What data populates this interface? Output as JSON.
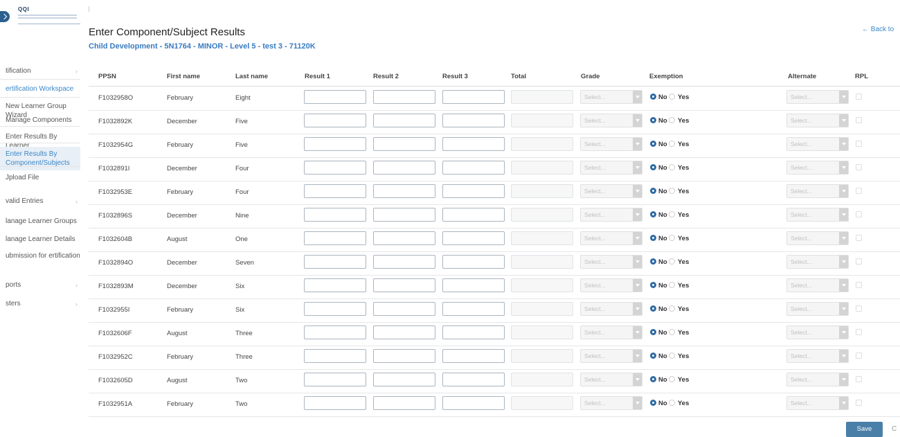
{
  "logo": {
    "text": "QQI"
  },
  "sidebar": {
    "items": [
      {
        "label": "tification",
        "chevron": true,
        "style": "plain"
      },
      {
        "label": "ertification Workspace",
        "chevron": false,
        "style": "blue"
      },
      {
        "label": "New Learner Group Wizard",
        "chevron": false,
        "style": "plain"
      },
      {
        "label": "Manage Components",
        "chevron": false,
        "style": "plain"
      },
      {
        "label": "Enter Results By Learner",
        "chevron": false,
        "style": "plain"
      },
      {
        "label": "Enter Results By Component/Subjects",
        "chevron": false,
        "style": "active"
      },
      {
        "label": "Jpload File",
        "chevron": false,
        "style": "plain"
      },
      {
        "label": "valid Entries",
        "chevron": true,
        "style": "plain"
      },
      {
        "label": "lanage Learner Groups",
        "chevron": false,
        "style": "plain"
      },
      {
        "label": "lanage Learner Details",
        "chevron": false,
        "style": "plain"
      },
      {
        "label": "ubmission for ertification",
        "chevron": false,
        "style": "plain"
      },
      {
        "label": "ports",
        "chevron": true,
        "style": "plain"
      },
      {
        "label": "sters",
        "chevron": true,
        "style": "plain"
      }
    ]
  },
  "header": {
    "title": "Enter Component/Subject Results",
    "subtitle": "Child Development - 5N1764 - MINOR - Level 5 - test 3 - 71120K",
    "back_link": "← Back to"
  },
  "table": {
    "columns": [
      "PPSN",
      "First name",
      "Last name",
      "Result 1",
      "Result 2",
      "Result 3",
      "Total",
      "Grade",
      "Exemption",
      "Alternate",
      "RPL"
    ],
    "select_placeholder": "Select...",
    "exemption_no": "No",
    "exemption_yes": "Yes",
    "rows": [
      {
        "ppsn": "F1032958O",
        "first": "February",
        "last": "Eight"
      },
      {
        "ppsn": "F1032892K",
        "first": "December",
        "last": "Five"
      },
      {
        "ppsn": "F1032954G",
        "first": "February",
        "last": "Five"
      },
      {
        "ppsn": "F1032891I",
        "first": "December",
        "last": "Four"
      },
      {
        "ppsn": "F1032953E",
        "first": "February",
        "last": "Four"
      },
      {
        "ppsn": "F1032896S",
        "first": "December",
        "last": "Nine"
      },
      {
        "ppsn": "F1032604B",
        "first": "August",
        "last": "One"
      },
      {
        "ppsn": "F1032894O",
        "first": "December",
        "last": "Seven"
      },
      {
        "ppsn": "F1032893M",
        "first": "December",
        "last": "Six"
      },
      {
        "ppsn": "F1032955I",
        "first": "February",
        "last": "Six"
      },
      {
        "ppsn": "F1032606F",
        "first": "August",
        "last": "Three"
      },
      {
        "ppsn": "F1032952C",
        "first": "February",
        "last": "Three"
      },
      {
        "ppsn": "F1032605D",
        "first": "August",
        "last": "Two"
      },
      {
        "ppsn": "F1032951A",
        "first": "February",
        "last": "Two"
      }
    ]
  },
  "footer": {
    "save_label": "Save",
    "cancel_stub": "C"
  },
  "colors": {
    "accent": "#3a87c8",
    "save_button": "#4a7fa8",
    "radio_selected": "#2f6aa3"
  }
}
